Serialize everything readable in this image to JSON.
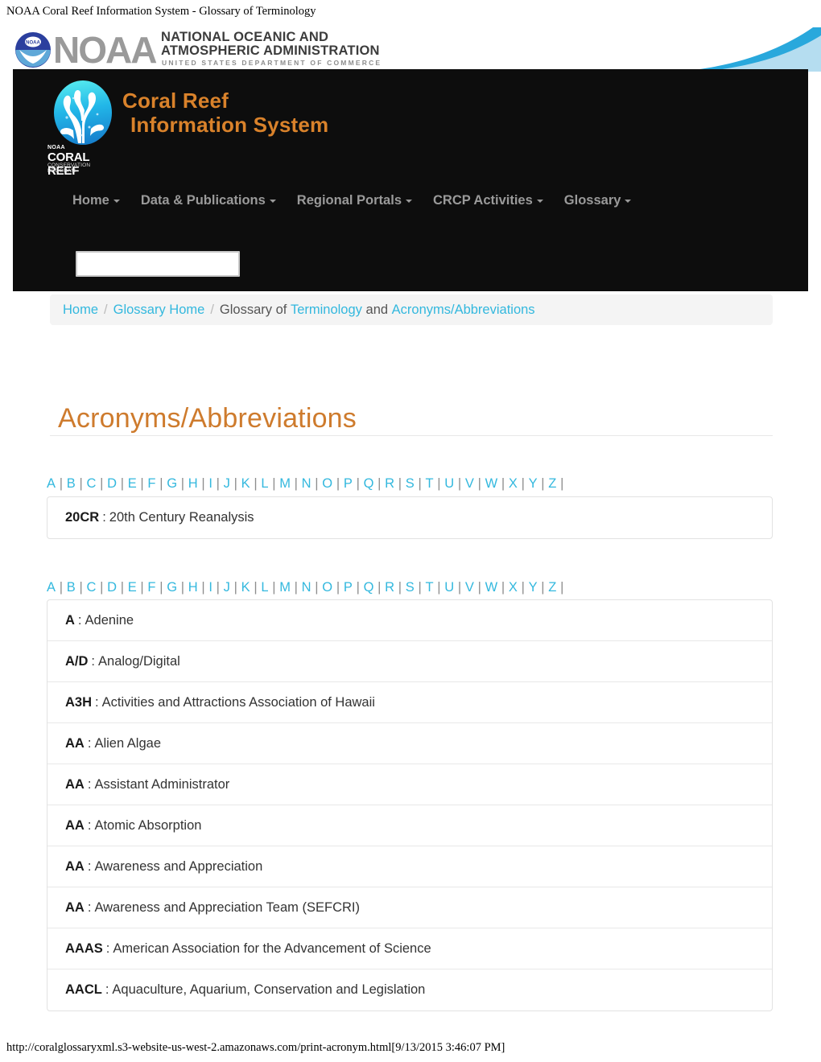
{
  "print": {
    "header": "NOAA Coral Reef Information System - Glossary of Terminology",
    "footer": "http://coralglossaryxml.s3-website-us-west-2.amazonaws.com/print-acronym.html[9/13/2015 3:46:07 PM]"
  },
  "noaa": {
    "wordmark": "NOAA",
    "line1": "NATIONAL OCEANIC AND",
    "line2": "ATMOSPHERIC ADMINISTRATION",
    "line3": "UNITED STATES DEPARTMENT OF COMMERCE",
    "seal_icon": "noaa-seal-icon",
    "swoosh_icon": "blue-wave-swoosh-icon"
  },
  "brand": {
    "title_line1": "Coral Reef",
    "title_line2": "Information System",
    "logo_icon": "coral-reef-disc-icon",
    "logo_caption1": "NOAA",
    "logo_caption2": "CORAL REEF",
    "logo_caption3": "CONSERVATION PROGRAM",
    "title_color": "#d9822b"
  },
  "nav": {
    "items": [
      {
        "label": "Home",
        "has_caret": true
      },
      {
        "label": "Data & Publications",
        "has_caret": true
      },
      {
        "label": "Regional Portals",
        "has_caret": true
      },
      {
        "label": "CRCP Activities",
        "has_caret": true
      },
      {
        "label": "Glossary",
        "has_caret": true
      }
    ]
  },
  "search": {
    "value": "",
    "placeholder": ""
  },
  "breadcrumb": {
    "home": "Home",
    "glossary_home": "Glossary Home",
    "prefix": "Glossary of",
    "terminology": "Terminology",
    "conjunction": "and",
    "acronyms": "Acronyms/Abbreviations",
    "separator": "/",
    "link_color": "#33b8de"
  },
  "main": {
    "page_title": "Acronyms/Abbreviations",
    "title_color": "#ce7b2d",
    "alphabet": [
      "A",
      "B",
      "C",
      "D",
      "E",
      "F",
      "G",
      "H",
      "I",
      "J",
      "K",
      "L",
      "M",
      "N",
      "O",
      "P",
      "Q",
      "R",
      "S",
      "T",
      "U",
      "V",
      "W",
      "X",
      "Y",
      "Z"
    ],
    "sections": [
      {
        "id": "numbers",
        "entries": [
          {
            "abbr": "20CR",
            "sep": ":",
            "def": "20th Century Reanalysis"
          }
        ]
      },
      {
        "id": "a",
        "entries": [
          {
            "abbr": "A",
            "sep": ":",
            "def": "Adenine"
          },
          {
            "abbr": "A/D",
            "sep": ":",
            "def": "Analog/Digital"
          },
          {
            "abbr": "A3H",
            "sep": ":",
            "def": "Activities and Attractions Association of Hawaii"
          },
          {
            "abbr": "AA",
            "sep": ":",
            "def": "Alien Algae"
          },
          {
            "abbr": "AA",
            "sep": ":",
            "def": "Assistant Administrator"
          },
          {
            "abbr": "AA",
            "sep": ":",
            "def": "Atomic Absorption"
          },
          {
            "abbr": "AA",
            "sep": ":",
            "def": "Awareness and Appreciation"
          },
          {
            "abbr": "AA",
            "sep": ":",
            "def": "Awareness and Appreciation Team (SEFCRI)"
          },
          {
            "abbr": "AAAS",
            "sep": ":",
            "def": "American Association for the Advancement of Science"
          },
          {
            "abbr": "AACL",
            "sep": ":",
            "def": "Aquaculture, Aquarium, Conservation and Legislation"
          }
        ]
      }
    ]
  }
}
